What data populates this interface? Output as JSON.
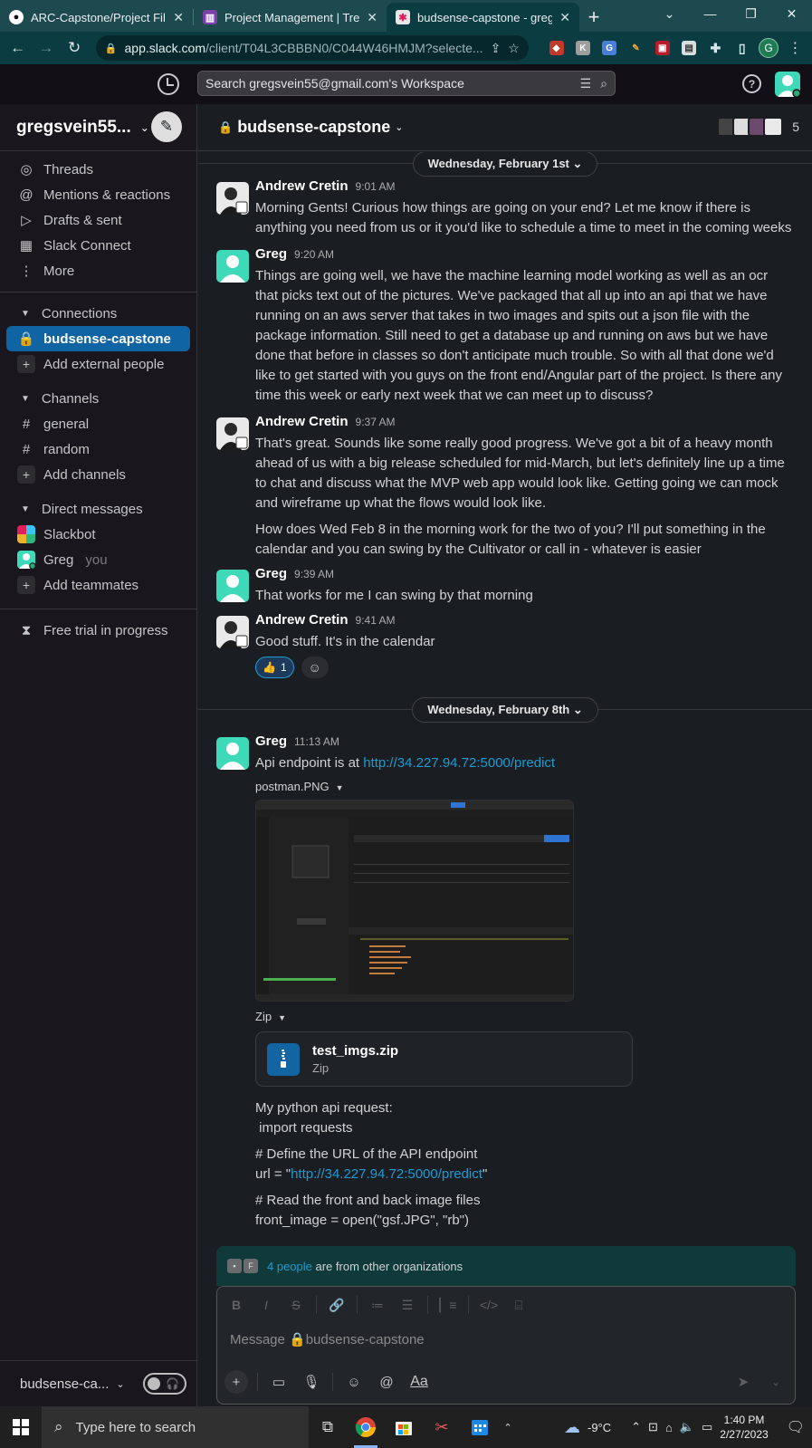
{
  "browser": {
    "tabs": [
      {
        "title": "ARC-Capstone/Project Files",
        "favicon": "github-icon",
        "active": false
      },
      {
        "title": "Project Management | Trello",
        "favicon": "trello-icon",
        "active": false
      },
      {
        "title": "budsense-capstone - gregs",
        "favicon": "slack-icon",
        "active": true
      }
    ],
    "new_tab": "+",
    "url_main": "app.slack.com",
    "url_path": "/client/T04L3CBBBN0/C044W46HMJM?selecte...",
    "profile_initial": "G"
  },
  "slack": {
    "search_placeholder": "Search gregsvein55@gmail.com's Workspace",
    "help": "?",
    "workspace_name": "gregsvein55...",
    "sidebar_top": [
      {
        "label": "Threads",
        "icon": "threads-icon",
        "glyph": "◎"
      },
      {
        "label": "Mentions & reactions",
        "icon": "at-icon",
        "glyph": "@"
      },
      {
        "label": "Drafts & sent",
        "icon": "send-icon",
        "glyph": "▷"
      },
      {
        "label": "Slack Connect",
        "icon": "building-icon",
        "glyph": "▦"
      },
      {
        "label": "More",
        "icon": "more-icon",
        "glyph": "⋮"
      }
    ],
    "connections_label": "Connections",
    "active_channel": "budsense-capstone",
    "add_external": "Add external people",
    "channels_label": "Channels",
    "channels": [
      "general",
      "random"
    ],
    "add_channels": "Add channels",
    "dm_label": "Direct messages",
    "dms": [
      {
        "name": "Slackbot",
        "you": ""
      },
      {
        "name": "Greg",
        "you": "you"
      }
    ],
    "add_teammates": "Add teammates",
    "free_trial": "Free trial in progress",
    "footer_ws": "budsense-ca...",
    "channel_title": "budsense-capstone",
    "member_count": "5",
    "days": [
      "Wednesday, February 1st",
      "Wednesday, February 8th"
    ],
    "messages": [
      {
        "name": "Andrew Cretin",
        "time": "9:01 AM",
        "paras": [
          "Morning Gents! Curious how things are going on your end? Let me know if there is anything you need from us or it you'd like to schedule a time to meet in the coming weeks"
        ]
      },
      {
        "name": "Greg",
        "time": "9:20 AM",
        "paras": [
          "Things are going well, we have the machine learning model working as well as an ocr that picks text out of the pictures. We've packaged that all up into an api that we have running on an aws server that takes in two images and spits out a json file with the package information. Still need to get a database up and running on aws but we have done that before in classes so don't anticipate much trouble. So with all that done we'd like to get started with you guys on the front end/Angular part of the project. Is there any time this week or early next week that we can meet up to discuss?"
        ]
      },
      {
        "name": "Andrew Cretin",
        "time": "9:37 AM",
        "paras": [
          "That's great. Sounds like some really good progress. We've got a bit of a heavy month ahead of us with a big release scheduled for mid-March, but let's definitely line up a time to chat and discuss what the MVP web app would look like. Getting going we can mock and wireframe up what the flows would look like.",
          "How does Wed Feb 8 in the morning work for the two of you? I'll put something in the calendar and you can swing by the Cultivator or call in - whatever is easier"
        ]
      },
      {
        "name": "Greg",
        "time": "9:39 AM",
        "paras": [
          "That works for me I can swing by that morning"
        ]
      },
      {
        "name": "Andrew Cretin",
        "time": "9:41 AM",
        "paras": [
          "Good stuff. It's in the calendar"
        ],
        "reaction_emoji": "👍",
        "reaction_count": "1"
      }
    ],
    "feb8": {
      "name": "Greg",
      "time": "11:13 AM",
      "api_prefix": "Api endpoint is at ",
      "api_link": "http://34.227.94.72:5000/predict",
      "image_label": "postman.PNG",
      "zip_label": "Zip",
      "zip_name": "test_imgs.zip",
      "zip_type": "Zip",
      "code_lines": [
        "My python api request:",
        " import requests"
      ],
      "code_comment1": "# Define the URL of the API endpoint",
      "url_prefix": "url = \"",
      "url_link": "http://34.227.94.72:5000/predict",
      "url_suffix": "\"",
      "code_comment2": "# Read the front and back image files",
      "code_line3": "front_image = open(\"gsf.JPG\", \"rb\")"
    },
    "notice_link": "4 people",
    "notice_rest": " are from other organizations",
    "composer_placeholder": "Message 🔒budsense-capstone",
    "aa": "Aa"
  },
  "taskbar": {
    "search": "Type here to search",
    "temperature": "-9°C",
    "time": "1:40 PM",
    "date": "2/27/2023"
  },
  "colors": {
    "accent": "#1164a3",
    "link": "#1d9bd1",
    "avatar_greg": "#3dd9b8"
  }
}
